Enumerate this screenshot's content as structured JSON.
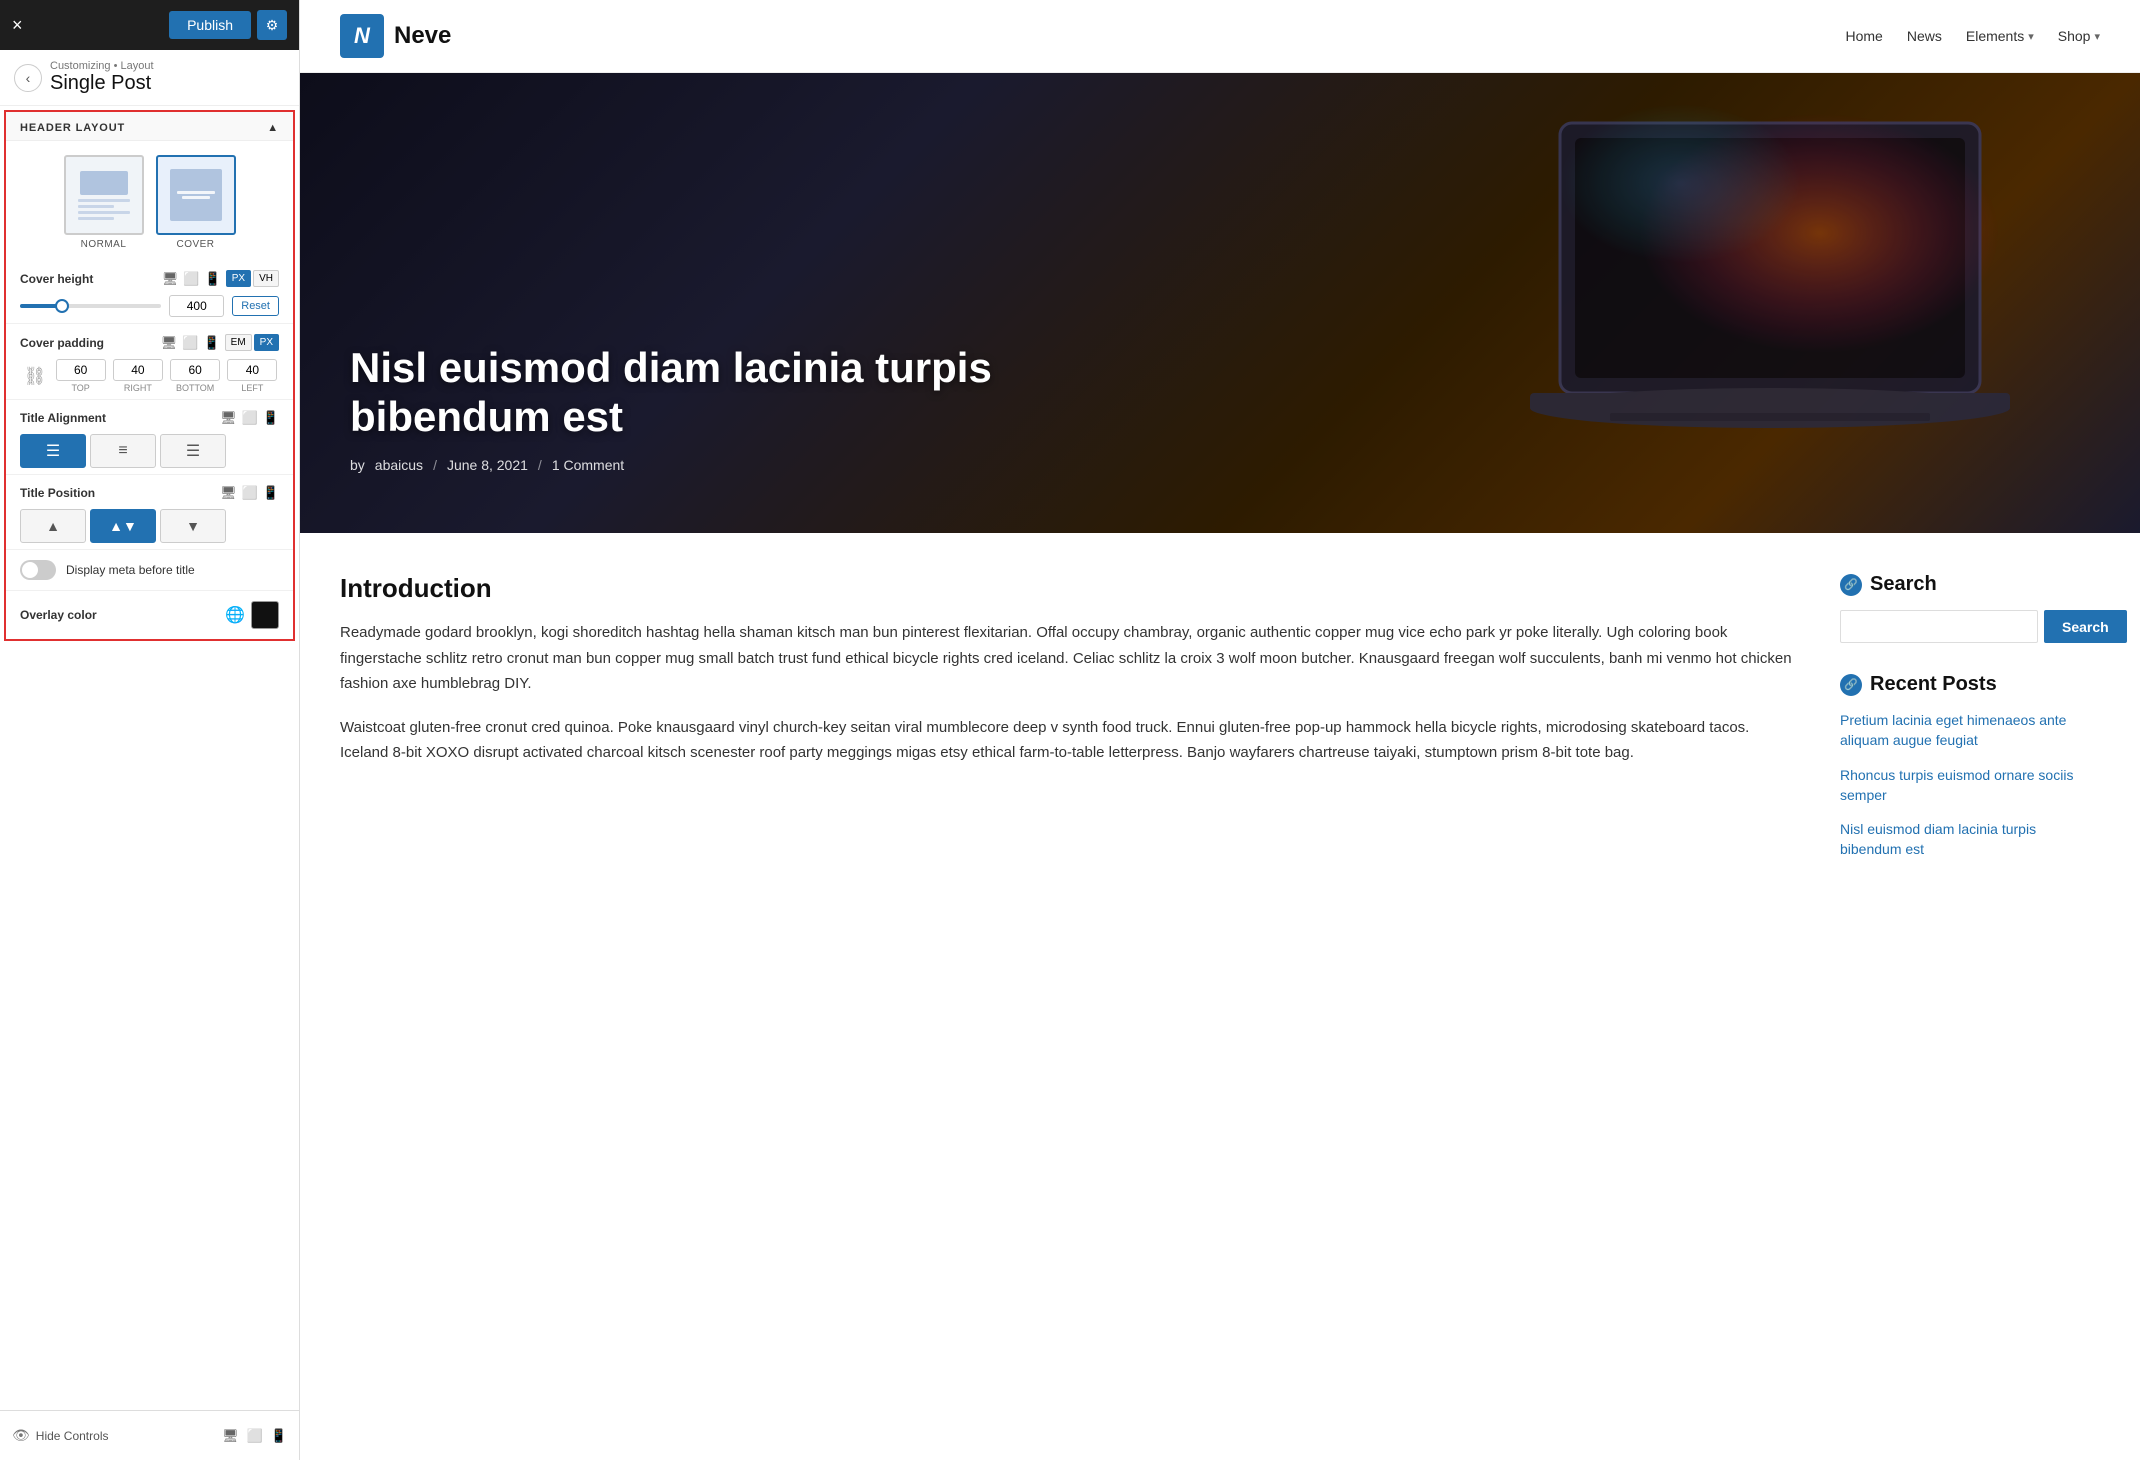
{
  "topbar": {
    "publish_label": "Publish",
    "close_icon": "×",
    "settings_icon": "⚙"
  },
  "breadcrumb": {
    "back_icon": "‹",
    "path": "Customizing • Layout",
    "title": "Single Post"
  },
  "header_layout": {
    "section_label": "HEADER LAYOUT",
    "collapse_icon": "▲",
    "options": [
      {
        "id": "normal",
        "label": "NORMAL",
        "selected": false
      },
      {
        "id": "cover",
        "label": "COVER",
        "selected": true
      }
    ]
  },
  "cover_height": {
    "label": "Cover height",
    "device_icons": [
      "🖥",
      "⬜",
      "📱"
    ],
    "units": [
      "PX",
      "VH"
    ],
    "active_unit": "PX",
    "value": "400",
    "reset_label": "Reset",
    "slider_percent": 30
  },
  "cover_padding": {
    "label": "Cover padding",
    "device_icons": [
      "🖥",
      "⬜",
      "📱"
    ],
    "units": [
      "EM",
      "PX"
    ],
    "active_unit": "PX",
    "top": "60",
    "right": "40",
    "bottom": "60",
    "left": "40",
    "top_label": "TOP",
    "right_label": "RIGHT",
    "bottom_label": "BOTTOM",
    "left_label": "LEFT"
  },
  "title_alignment": {
    "label": "Title Alignment",
    "device_icons": [
      "🖥",
      "⬜",
      "📱"
    ],
    "options": [
      "left",
      "center",
      "right"
    ],
    "active": "left"
  },
  "title_position": {
    "label": "Title Position",
    "device_icons": [
      "🖥",
      "⬜",
      "📱"
    ],
    "options": [
      "top",
      "middle",
      "bottom"
    ],
    "active": "middle"
  },
  "display_meta": {
    "label": "Display meta before title",
    "on": false
  },
  "overlay_color": {
    "label": "Overlay color",
    "globe_icon": "🌐",
    "color": "#111111"
  },
  "bottom_bar": {
    "hide_label": "Hide Controls",
    "device_icons": [
      "🖥",
      "⬜",
      "📱"
    ]
  },
  "site": {
    "logo_letter": "N",
    "name": "Neve",
    "nav": [
      {
        "label": "Home",
        "has_dropdown": false
      },
      {
        "label": "News",
        "has_dropdown": false
      },
      {
        "label": "Elements",
        "has_dropdown": true
      },
      {
        "label": "Shop",
        "has_dropdown": true
      }
    ]
  },
  "hero": {
    "title": "Nisl euismod diam lacinia turpis bibendum est",
    "author": "abaicus",
    "date": "June 8, 2021",
    "comments": "1 Comment"
  },
  "article": {
    "intro_title": "Introduction",
    "paragraphs": [
      "Readymade godard brooklyn, kogi shoreditch hashtag hella shaman kitsch man bun pinterest flexitarian. Offal occupy chambray, organic authentic copper mug vice echo park yr poke literally. Ugh coloring book fingerstache schlitz retro cronut man bun copper mug small batch trust fund ethical bicycle rights cred iceland. Celiac schlitz la croix 3 wolf moon butcher. Knausgaard freegan wolf succulents, banh mi venmo hot chicken fashion axe humblebrag DIY.",
      "Waistcoat gluten-free cronut cred quinoa. Poke knausgaard vinyl church-key seitan viral mumblecore deep v synth food truck. Ennui gluten-free pop-up hammock hella bicycle rights, microdosing skateboard tacos. Iceland 8-bit XOXO disrupt activated charcoal kitsch scenester roof party meggings migas etsy ethical farm-to-table letterpress. Banjo wayfarers chartreuse taiyaki, stumptown prism 8-bit tote bag."
    ]
  },
  "sidebar": {
    "search_title": "Search",
    "search_placeholder": "",
    "search_btn": "Search",
    "recent_title": "Recent Posts",
    "recent_posts": [
      "Pretium lacinia eget himenaeos ante aliquam augue feugiat",
      "Rhoncus turpis euismod ornare sociis semper",
      "Nisl euismod diam lacinia turpis bibendum est"
    ]
  }
}
